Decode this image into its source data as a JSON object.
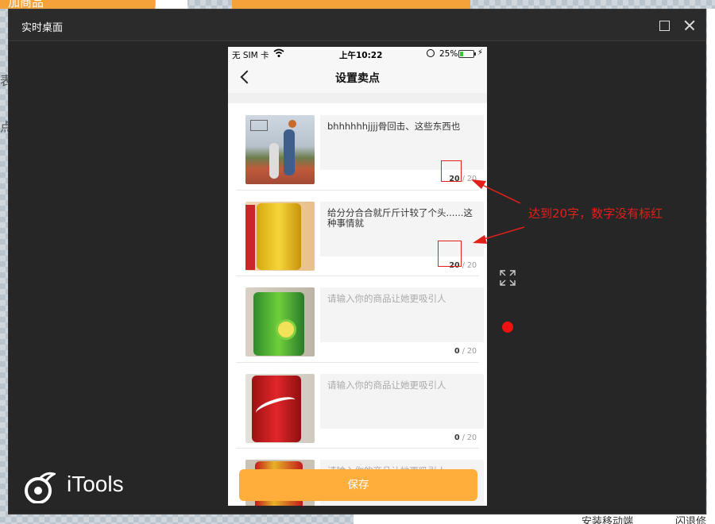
{
  "window": {
    "title": "实时桌面"
  },
  "background": {
    "left_top_text": "加商品",
    "left_text_1": "表",
    "left_text_2": "点",
    "bottom_text_1": "安装移动端",
    "bottom_text_2": "闪退修复"
  },
  "phone": {
    "status": {
      "carrier": "无 SIM 卡",
      "time": "上午10:22",
      "battery_pct": "25%",
      "battery_level": 0.25
    },
    "nav": {
      "title": "设置卖点"
    },
    "items": [
      {
        "text": "bhhhhhhjjjj骨回击、这些东西也",
        "placeholder": "",
        "count": "20",
        "max": "/ 20"
      },
      {
        "text": "给分分合合就斤斤计较了个头......这种事情就",
        "placeholder": "",
        "count": "20",
        "max": "/ 20"
      },
      {
        "text": "",
        "placeholder": "请输入你的商品让她更吸引人",
        "count": "0",
        "max": "/ 20"
      },
      {
        "text": "",
        "placeholder": "请输入你的商品让她更吸引人",
        "count": "0",
        "max": "/ 20"
      },
      {
        "text": "",
        "placeholder": "请输入你的商品让她更吸引人",
        "count": "",
        "max": ""
      }
    ],
    "save_label": "保存"
  },
  "annotation": {
    "text": "达到20字，数字没有标红",
    "color": "#e0201b"
  },
  "brand": {
    "name": "iTools"
  },
  "colors": {
    "accent": "#ffad3b",
    "window_bg": "#262626",
    "annotation": "#e0201b"
  }
}
